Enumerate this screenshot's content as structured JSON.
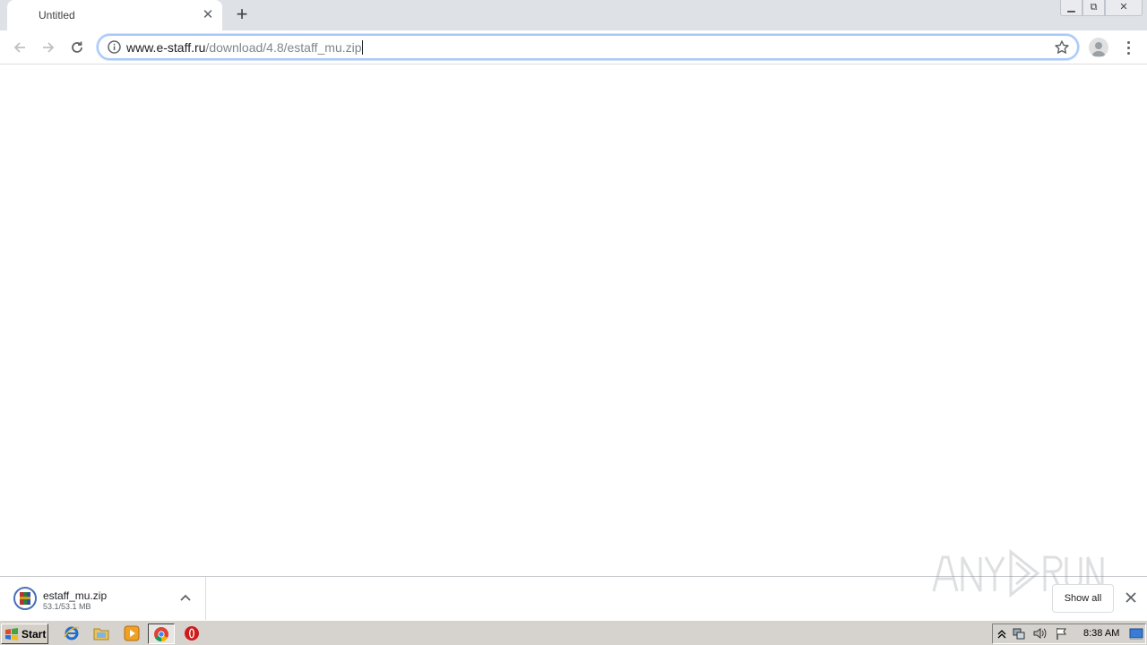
{
  "browser": {
    "tab": {
      "title": "Untitled",
      "close_icon": "close-icon"
    },
    "new_tab_icon": "plus-icon",
    "address_bar": {
      "url_host": "www.e-staff.ru",
      "url_path": "/download/4.8/estaff_mu.zip"
    }
  },
  "download_shelf": {
    "file_name": "estaff_mu.zip",
    "progress": "53.1/53.1 MB",
    "show_all_label": "Show all"
  },
  "taskbar": {
    "start_label": "Start",
    "clock": "8:38 AM"
  },
  "colors": {
    "tabstrip_bg": "#dee1e6",
    "omnibox_focus": "#a8c7fa",
    "taskbar_bg": "#d6d3ce"
  }
}
